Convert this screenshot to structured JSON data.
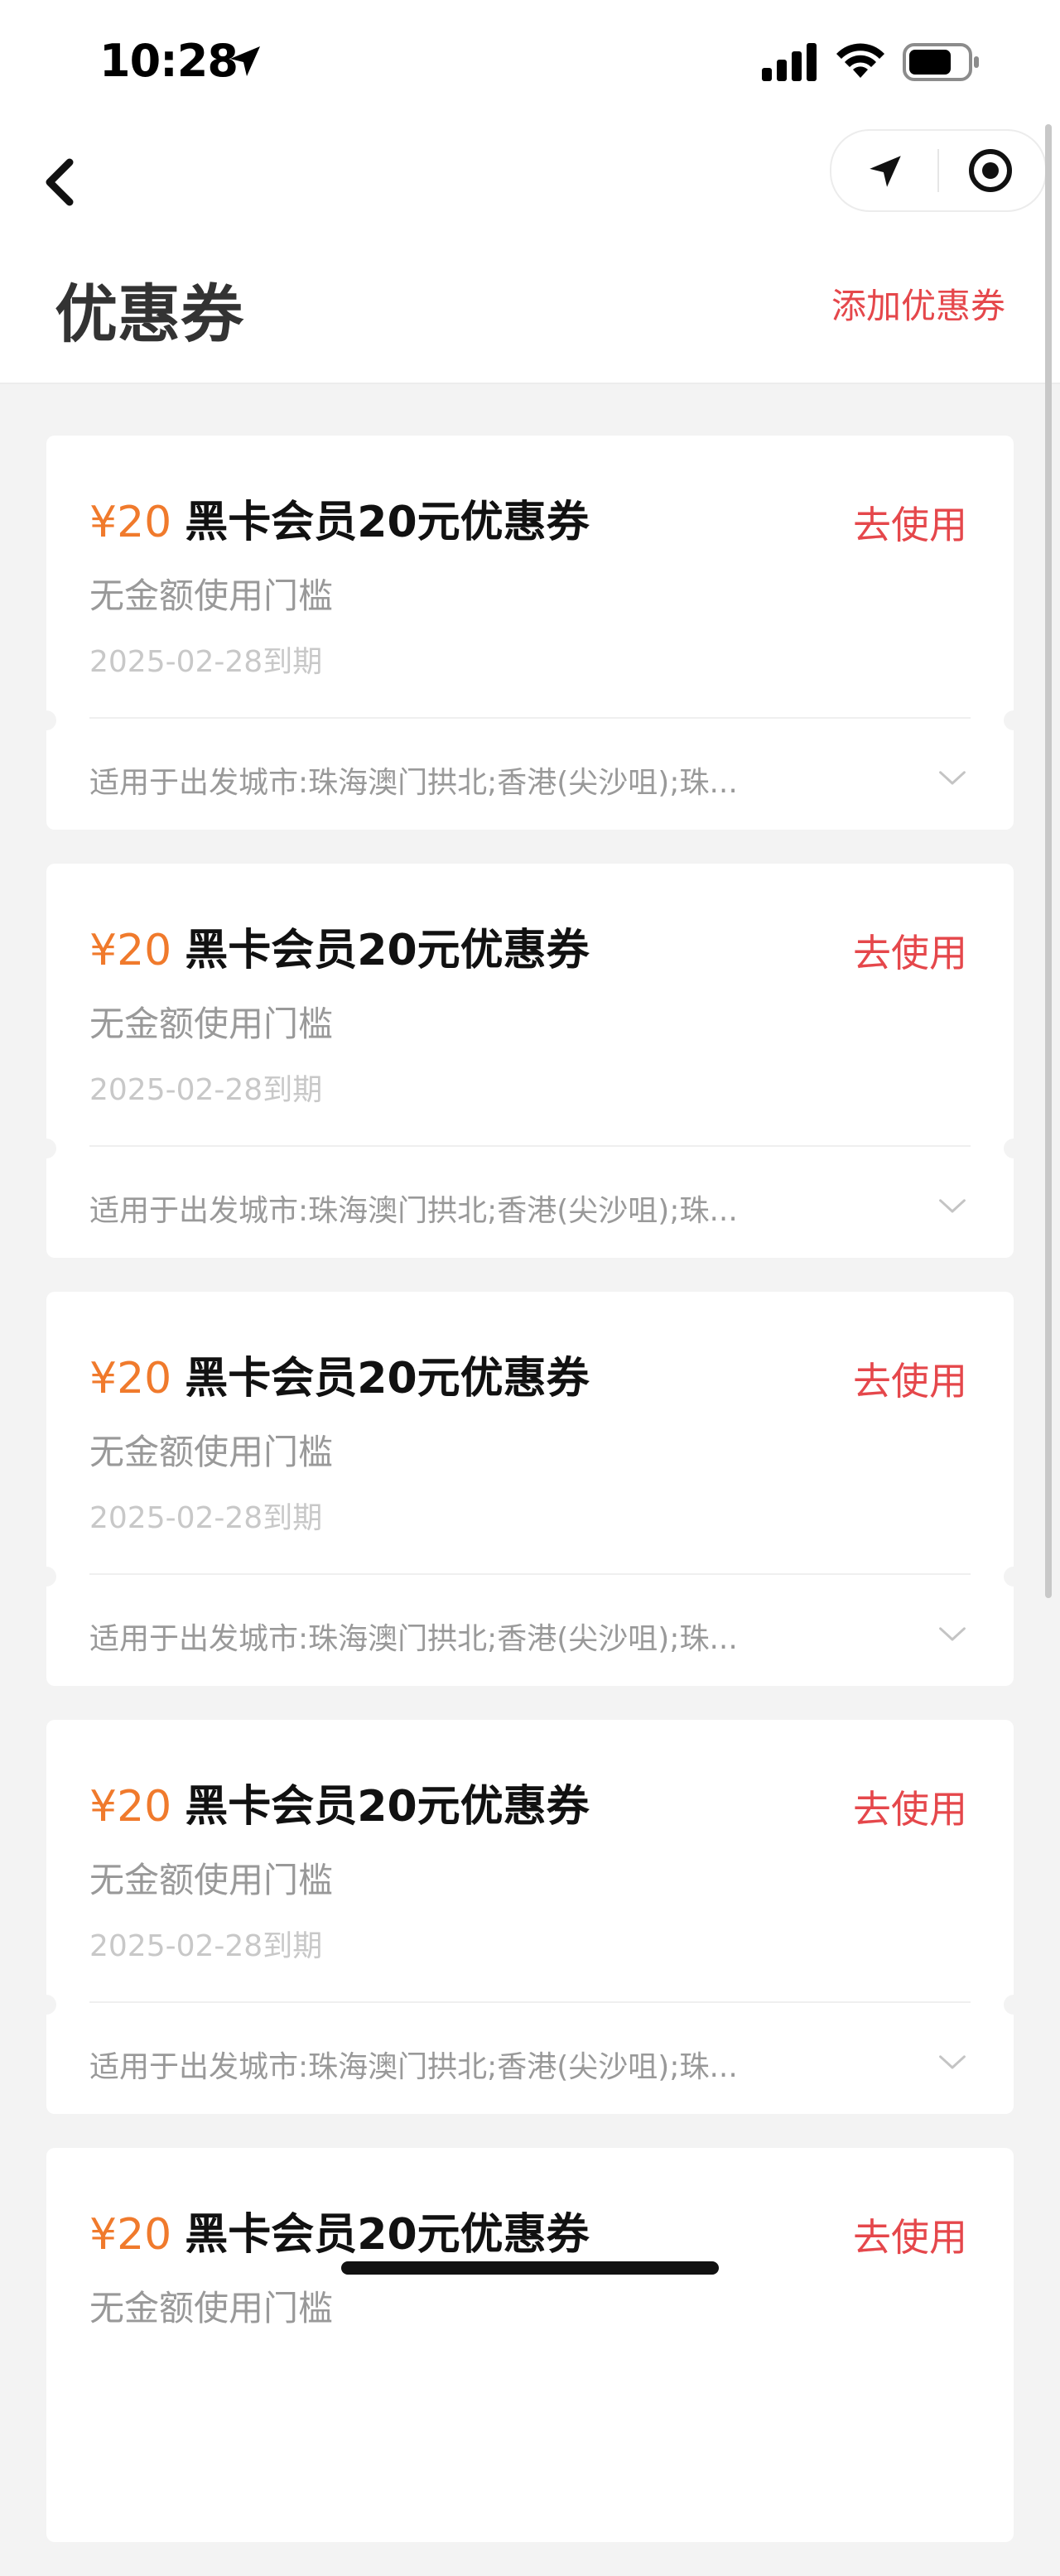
{
  "status_bar": {
    "time": "10:28"
  },
  "header": {
    "title": "优惠券",
    "add_coupon": "添加优惠券"
  },
  "coupons": [
    {
      "amount": "¥20",
      "name": "黑卡会员20元优惠券",
      "use_label": "去使用",
      "condition": "无金额使用门槛",
      "expiry": "2025-02-28到期",
      "scope": "适用于出发城市:珠海澳门拱北;香港(尖沙咀);珠..."
    },
    {
      "amount": "¥20",
      "name": "黑卡会员20元优惠券",
      "use_label": "去使用",
      "condition": "无金额使用门槛",
      "expiry": "2025-02-28到期",
      "scope": "适用于出发城市:珠海澳门拱北;香港(尖沙咀);珠..."
    },
    {
      "amount": "¥20",
      "name": "黑卡会员20元优惠券",
      "use_label": "去使用",
      "condition": "无金额使用门槛",
      "expiry": "2025-02-28到期",
      "scope": "适用于出发城市:珠海澳门拱北;香港(尖沙咀);珠..."
    },
    {
      "amount": "¥20",
      "name": "黑卡会员20元优惠券",
      "use_label": "去使用",
      "condition": "无金额使用门槛",
      "expiry": "2025-02-28到期",
      "scope": "适用于出发城市:珠海澳门拱北;香港(尖沙咀);珠..."
    },
    {
      "amount": "¥20",
      "name": "黑卡会员20元优惠券",
      "use_label": "去使用",
      "condition": "无金额使用门槛",
      "expiry": "",
      "scope": ""
    }
  ],
  "colors": {
    "accent_red": "#e5474b",
    "amount_orange": "#f07a2c"
  },
  "icons": [
    "location-arrow-icon",
    "signal-icon",
    "wifi-icon",
    "battery-icon",
    "back-chevron-icon",
    "navigation-icon",
    "record-icon",
    "chevron-down-icon"
  ]
}
